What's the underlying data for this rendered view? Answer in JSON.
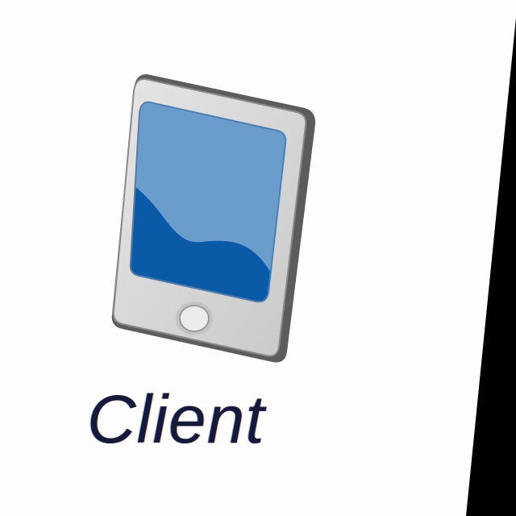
{
  "node": {
    "label": "Client",
    "icon": "tablet-device-icon"
  },
  "colors": {
    "background": "#fdfdfd",
    "label_text": "#161a3a",
    "device_frame": "#d4d4d4",
    "device_edge": "#5c5c5c",
    "screen_light": "#6a9dcc",
    "screen_dark": "#0a5aa8",
    "panel": "#000000"
  }
}
